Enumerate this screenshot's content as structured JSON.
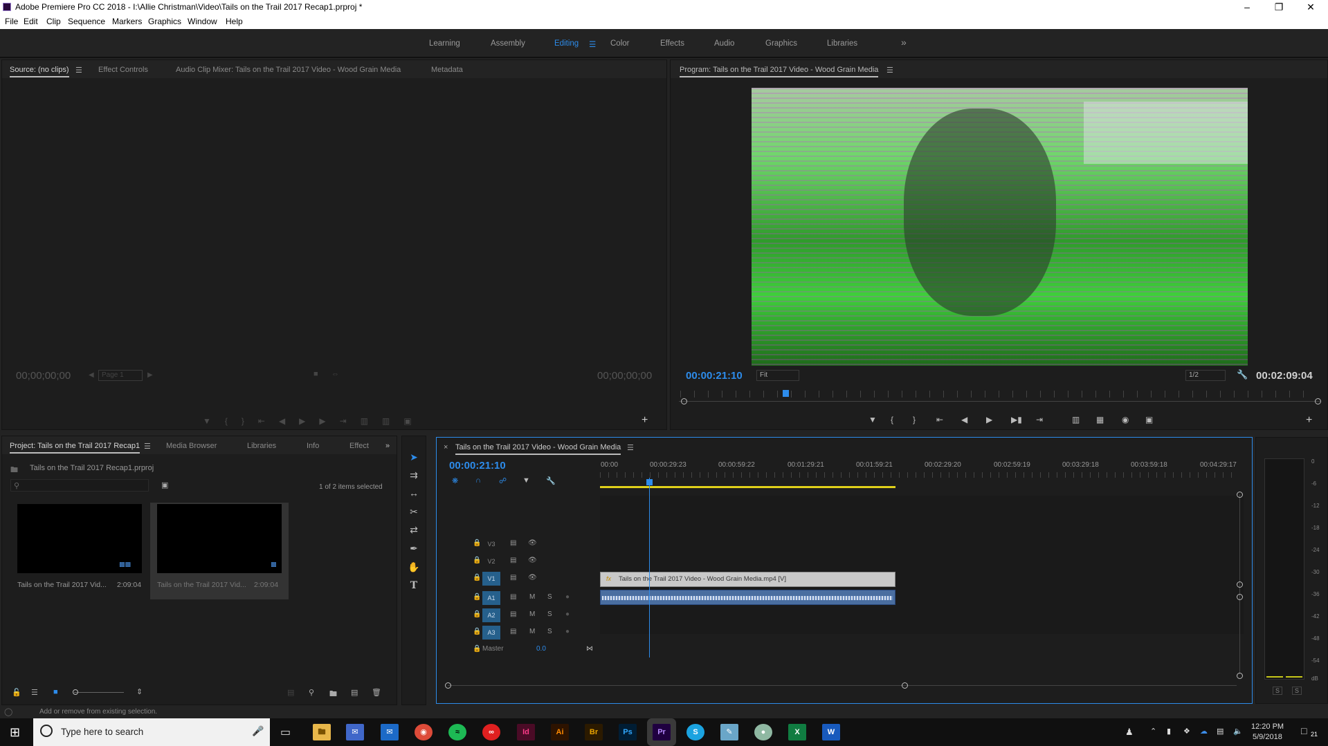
{
  "window": {
    "title": "Adobe Premiere Pro CC 2018 - I:\\Allie Christman\\Video\\Tails on the Trail 2017 Recap1.prproj *"
  },
  "menu": [
    "File",
    "Edit",
    "Clip",
    "Sequence",
    "Markers",
    "Graphics",
    "Window",
    "Help"
  ],
  "workspaces": {
    "items": [
      "Learning",
      "Assembly",
      "Editing",
      "Color",
      "Effects",
      "Audio",
      "Graphics",
      "Libraries"
    ],
    "active": "Editing",
    "overflow": "»"
  },
  "source_panel": {
    "tabs": [
      "Source: (no clips)",
      "Effect Controls",
      "Audio Clip Mixer: Tails on the Trail 2017 Video - Wood Grain Media",
      "Metadata"
    ],
    "timecode_in": "00;00;00;00",
    "timecode_out": "00;00;00;00",
    "page": "Page 1"
  },
  "program_panel": {
    "title": "Program: Tails on the Trail 2017 Video - Wood Grain Media",
    "timecode": "00:00:21:10",
    "fit": "Fit",
    "resolution": "1/2",
    "duration": "00:02:09:04"
  },
  "project_panel": {
    "tabs": [
      "Project: Tails on the Trail 2017 Recap1",
      "Media Browser",
      "Libraries",
      "Info",
      "Effect"
    ],
    "path": "Tails on the Trail 2017 Recap1.prproj",
    "selection": "1 of 2 items selected",
    "items": [
      {
        "name": "Tails on the Trail 2017 Vid...",
        "duration": "2:09:04"
      },
      {
        "name": "Tails on the Trail 2017 Vid...",
        "duration": "2:09:04"
      }
    ]
  },
  "timeline": {
    "tab": "Tails on the Trail 2017 Video - Wood Grain Media",
    "timecode": "00:00:21:10",
    "ruler": [
      "00:00",
      "00:00:29:23",
      "00:00:59:22",
      "00:01:29:21",
      "00:01:59:21",
      "00:02:29:20",
      "00:02:59:19",
      "00:03:29:18",
      "00:03:59:18",
      "00:04:29:17"
    ],
    "video_tracks": [
      "V3",
      "V2",
      "V1"
    ],
    "audio_tracks": [
      "A1",
      "A2",
      "A3"
    ],
    "master_label": "Master",
    "master_value": "0.0",
    "clip_label": "Tails on the Trail 2017 Video - Wood Grain Media.mp4 [V]"
  },
  "meter": {
    "labels": [
      "0",
      "-6",
      "-12",
      "-18",
      "-24",
      "-30",
      "-36",
      "-42",
      "-48",
      "-54",
      "dB"
    ],
    "solo": [
      "S",
      "S"
    ]
  },
  "status": {
    "text": "Add or remove from existing selection."
  },
  "taskbar": {
    "search": "Type here to search",
    "time": "12:20 PM",
    "date": "5/9/2018",
    "notif": "21",
    "apps": [
      "Id",
      "Ai",
      "Br",
      "Ps",
      "Pr",
      "X",
      "W"
    ]
  },
  "colors": {
    "accent": "#2d8ceb",
    "bg": "#1d1d1d",
    "playhead": "#2d8ceb",
    "workarea": "#e0d01a"
  }
}
